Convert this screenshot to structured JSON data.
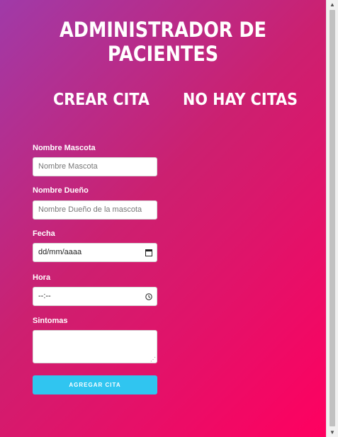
{
  "header": {
    "title": "ADMINISTRADOR DE PACIENTES"
  },
  "sections": {
    "create_title": "CREAR CITA",
    "list_title": "NO HAY CITAS"
  },
  "form": {
    "pet_name": {
      "label": "Nombre Mascota",
      "placeholder": "Nombre Mascota"
    },
    "owner_name": {
      "label": "Nombre Dueño",
      "placeholder": "Nombre  Dueño de la mascota"
    },
    "date": {
      "label": "Fecha",
      "value": "dd/mm/aaaa",
      "icon": "calendar-icon"
    },
    "time": {
      "label": "Hora",
      "value": "--:--",
      "icon": "clock-icon"
    },
    "symptoms": {
      "label": "Sintomas",
      "value": ""
    },
    "submit_label": "AGREGAR CITA"
  },
  "colors": {
    "gradient_start": "#a03aa8",
    "gradient_end": "#ff0060",
    "button": "#30c5f0"
  }
}
